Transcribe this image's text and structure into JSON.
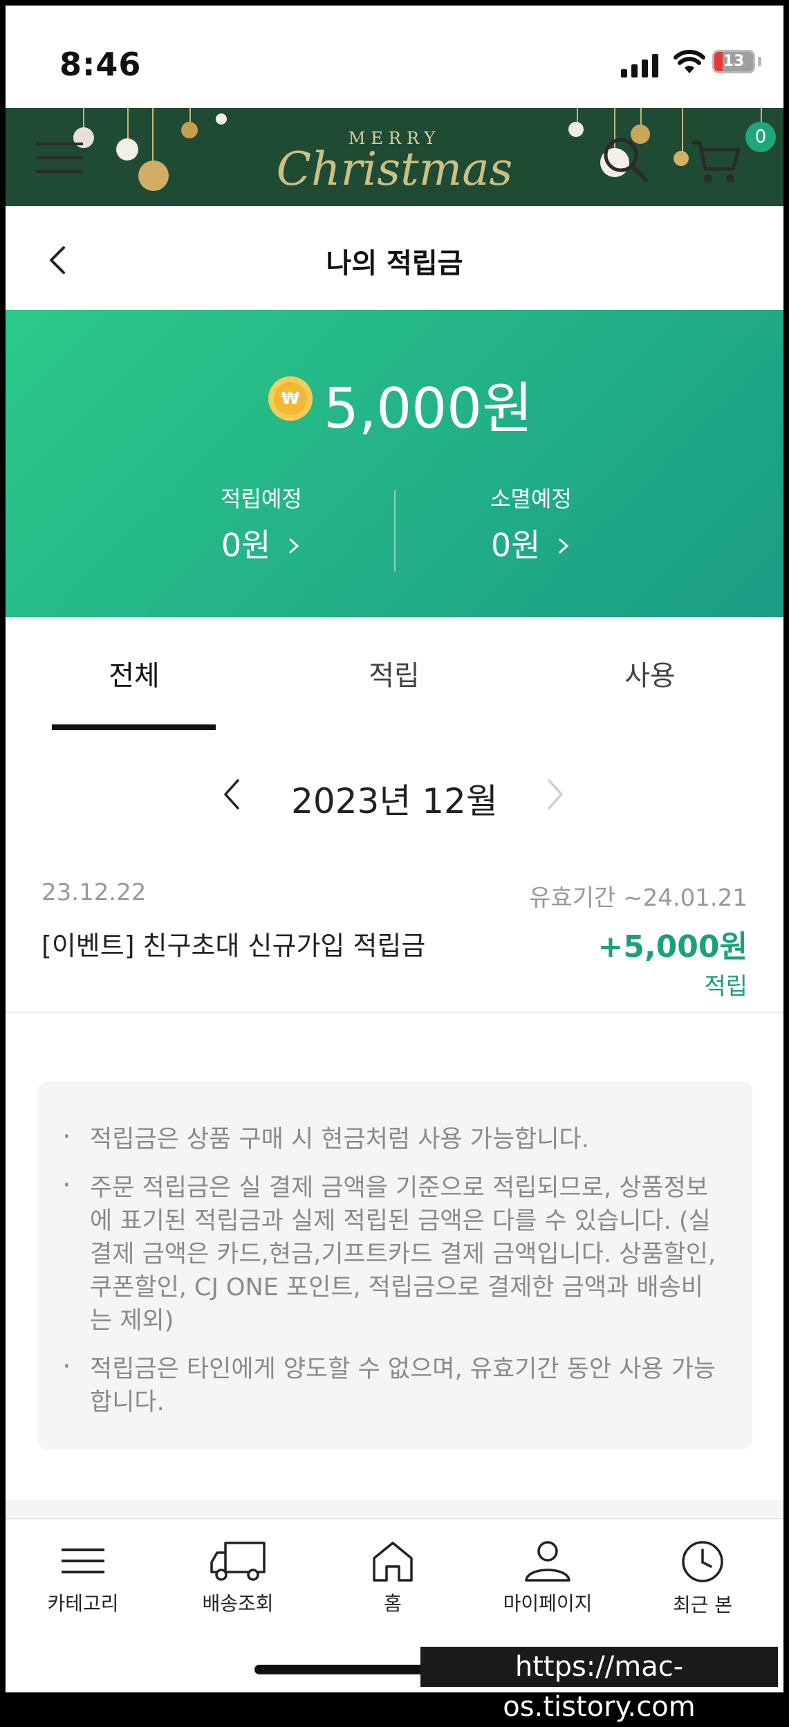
{
  "status_bar": {
    "time": "8:46",
    "battery": "13"
  },
  "banner": {
    "merry": "MERRY",
    "christmas": "Christmas",
    "cart_count": "0"
  },
  "header": {
    "title": "나의 적립금"
  },
  "balance": {
    "amount": "5,000원",
    "coin_symbol": "₩",
    "pending": {
      "label": "적립예정",
      "value": "0원"
    },
    "expiring": {
      "label": "소멸예정",
      "value": "0원"
    }
  },
  "tabs": [
    {
      "label": "전체",
      "active": true
    },
    {
      "label": "적립",
      "active": false
    },
    {
      "label": "사용",
      "active": false
    }
  ],
  "month": {
    "label": "2023년 12월"
  },
  "transactions": [
    {
      "date": "23.12.22",
      "expiry": "유효기간 ~24.01.21",
      "name": "[이벤트] 친구초대 신규가입 적립금",
      "amount": "+5,000원",
      "type": "적립"
    }
  ],
  "notice": [
    "적립금은 상품 구매 시 현금처럼 사용 가능합니다.",
    "주문 적립금은 실 결제 금액을 기준으로 적립되므로, 상품정보에 표기된 적립금과 실제 적립된 금액은 다를 수 있습니다. (실 결제 금액은 카드,현금,기프트카드 결제 금액입니다. 상품할인, 쿠폰할인, CJ ONE 포인트, 적립금으로 결제한 금액과 배송비는 제외)",
    "적립금은 타인에게 양도할 수 없으며, 유효기간 동안 사용 가능합니다."
  ],
  "bottom_nav": [
    {
      "label": "카테고리",
      "icon": "menu-icon"
    },
    {
      "label": "배송조회",
      "icon": "truck-icon"
    },
    {
      "label": "홈",
      "icon": "home-icon"
    },
    {
      "label": "마이페이지",
      "icon": "person-icon"
    },
    {
      "label": "최근 본",
      "icon": "clock-icon"
    }
  ],
  "watermark": "https://mac-os.tistory.com",
  "colors": {
    "accent": "#1ba17a",
    "card_start": "#2cc98a",
    "card_end": "#1a9c85",
    "banner_bg": "#1f4a33"
  }
}
